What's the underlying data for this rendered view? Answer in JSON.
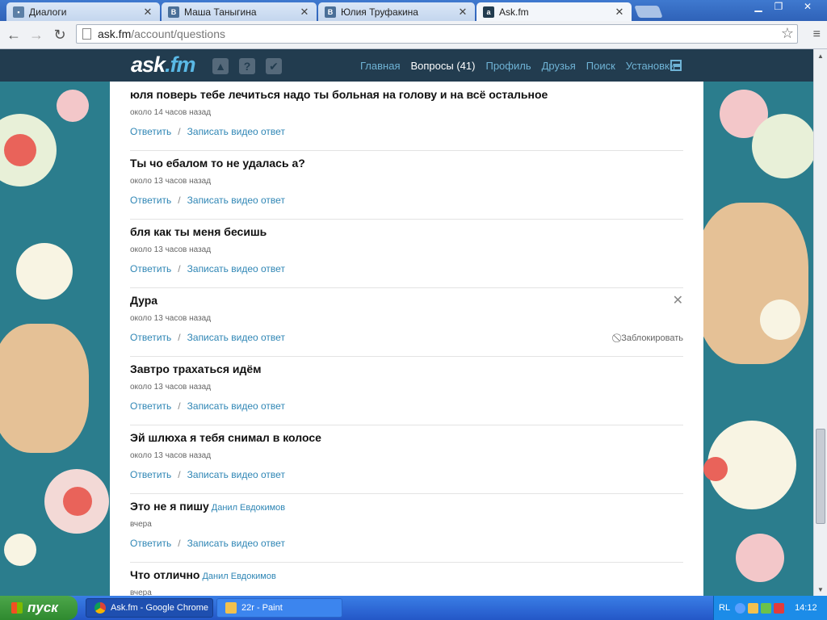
{
  "browser": {
    "tabs": [
      {
        "title": "Диалоги",
        "icon": "speech-icon"
      },
      {
        "title": "Маша Таныгина",
        "icon": "vk-icon"
      },
      {
        "title": "Юлия Труфакина",
        "icon": "vk-icon"
      },
      {
        "title": "Ask.fm",
        "icon": "askfm-icon"
      }
    ],
    "url_host": "ask.fm",
    "url_path": "/account/questions"
  },
  "site": {
    "logo": "ask",
    "logo_suffix": ".fm",
    "nav": [
      "Главная",
      "Вопросы (41)",
      "Профиль",
      "Друзья",
      "Поиск",
      "Установки"
    ],
    "nav_current_index": 1
  },
  "questions": [
    {
      "text": "юля поверь тебе лечиться надо ты больная на голову и на всё остальное",
      "author": "",
      "time": "около 14 часов назад"
    },
    {
      "text": "Ты чо ебалом то не удалась а?",
      "author": "",
      "time": "около 13 часов назад"
    },
    {
      "text": "бля как ты меня бесишь",
      "author": "",
      "time": "около 13 часов назад"
    },
    {
      "text": "Дура",
      "author": "",
      "time": "около 13 часов назад"
    },
    {
      "text": "Завтро трахаться идём",
      "author": "",
      "time": "около 13 часов назад"
    },
    {
      "text": "Эй шлюха я тебя снимал в колосе",
      "author": "",
      "time": "около 13 часов назад"
    },
    {
      "text": "Это не я пишу",
      "author": "Данил Евдокимов",
      "time": "вчера"
    },
    {
      "text": "Что отлично",
      "author": "Данил Евдокимов",
      "time": "вчера"
    }
  ],
  "actions": {
    "answer": "Ответить",
    "separator": "/",
    "video": "Записать видео ответ"
  },
  "hover": {
    "close": "✕",
    "block": "Заблокировать"
  },
  "taskbar": {
    "start": "пуск",
    "items": [
      "Ask.fm - Google Chrome",
      "22r - Paint"
    ],
    "lang": "RL",
    "clock": "14:12"
  },
  "colors": {
    "header": "#223c4f",
    "link": "#2f86b5",
    "taskbar": "#2457c7",
    "start": "#3c9a3c"
  }
}
